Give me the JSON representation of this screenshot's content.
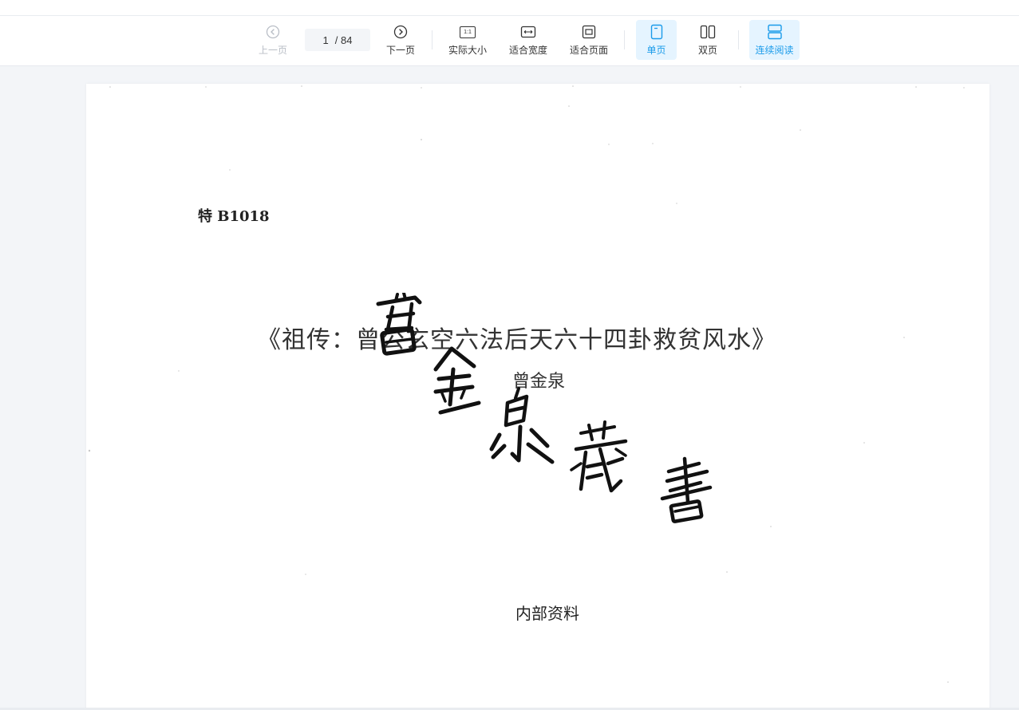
{
  "toolbar": {
    "prev_label": "上一页",
    "next_label": "下一页",
    "page_current": "1",
    "page_total": "/ 84",
    "actual_size_label": "实际大小",
    "actual_size_glyph": "1:1",
    "fit_width_label": "适合宽度",
    "fit_page_label": "适合页面",
    "single_page_label": "单页",
    "double_page_label": "双页",
    "continuous_label": "连续阅读",
    "accent_color": "#1a9bea",
    "active_bg": "#e5f4ff"
  },
  "document": {
    "code": "特 B1018",
    "title": "《祖传：曾公玄空六法后天六十四卦救贫风水》",
    "author": "曾金泉",
    "internal_note": "内部资料",
    "stamp_text": "曾金泉藏書"
  }
}
